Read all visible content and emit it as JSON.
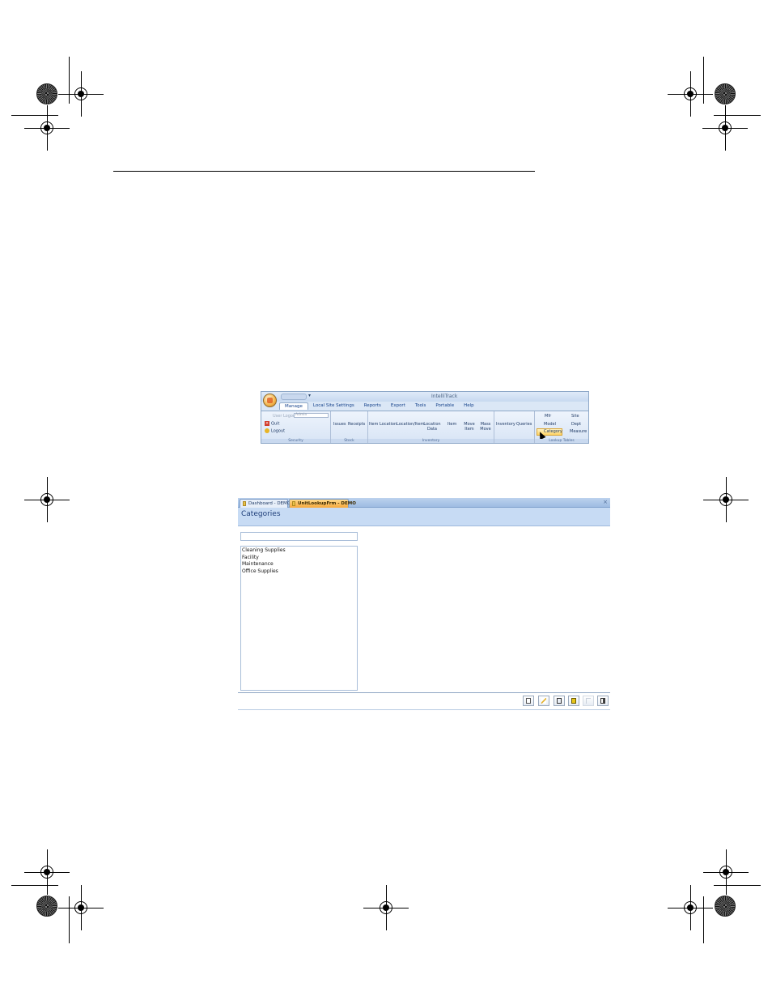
{
  "ribbon": {
    "app_title": "IntelliTrack",
    "qat_more": "▾",
    "tabs": [
      {
        "label": "Manage"
      },
      {
        "label": "Local Site Settings"
      },
      {
        "label": "Reports"
      },
      {
        "label": "Export"
      },
      {
        "label": "Tools"
      },
      {
        "label": "Portable"
      },
      {
        "label": "Help"
      }
    ],
    "security": {
      "user_logon_label": "User Logon",
      "user_value": "Admin",
      "quit": "Quit",
      "logout": "Logout",
      "group_label": "Security"
    },
    "stock": {
      "issues": "Issues",
      "receipts": "Receipts",
      "group_label": "Stock"
    },
    "inventory": {
      "item_location": "Item Location",
      "location_item": "Location/Item",
      "location_data": "Location Data",
      "item": "Item",
      "move_item": "Move Item",
      "mass_move": "Mass Move",
      "group_label": "Inventory"
    },
    "inventory2": {
      "inventory": "Inventory",
      "queries": "Queries"
    },
    "lookup": {
      "mfr": "Mfr",
      "site": "Site",
      "model": "Model",
      "dept": "Dept",
      "category": "Category",
      "measure": "Measure",
      "group_label": "Lookup Tables"
    }
  },
  "window": {
    "tabs": [
      {
        "label": "Dashboard - DEMO"
      },
      {
        "label": "UnitLookupFrm - DEMO"
      }
    ],
    "close_label": "×",
    "title": "Categories",
    "search_value": "",
    "list_items": [
      "Cleaning Supplies",
      "Facility",
      "Maintenance",
      "Office Supplies"
    ],
    "footer_buttons": [
      {
        "icon": "new-record-icon"
      },
      {
        "icon": "edit-icon"
      },
      {
        "icon": "save-icon"
      },
      {
        "icon": "delete-icon"
      },
      {
        "icon": "undo-icon"
      },
      {
        "icon": "exit-icon"
      }
    ]
  }
}
